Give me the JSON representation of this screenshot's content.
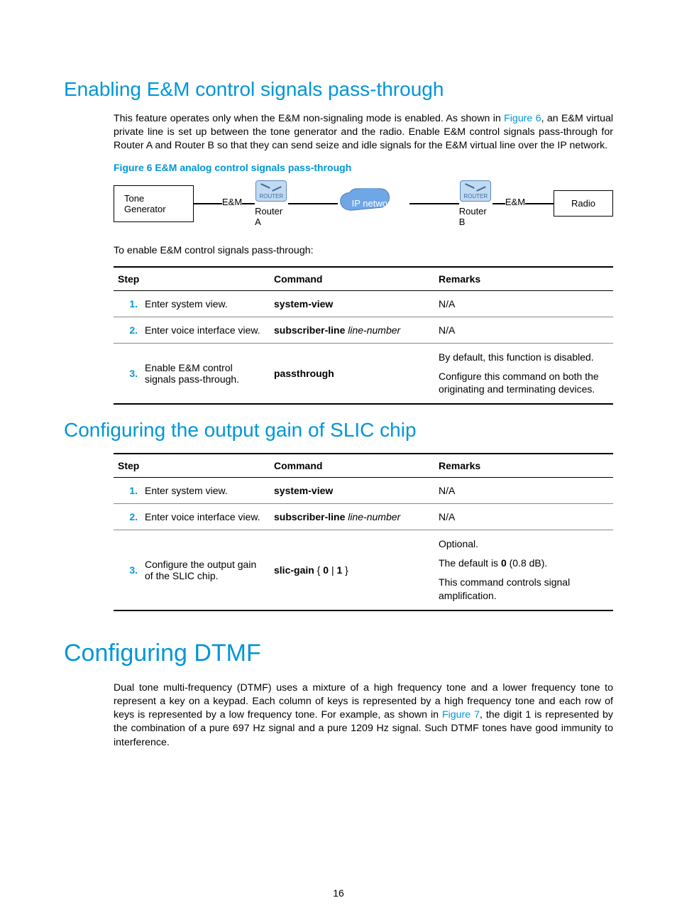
{
  "pageNumber": "16",
  "sections": {
    "s1": {
      "heading": "Enabling E&M control signals pass-through",
      "para_pre": "This feature operates only when the E&M non-signaling mode is enabled. As shown in ",
      "para_link": "Figure 6",
      "para_post": ", an E&M virtual private line is set up between the tone generator and the radio. Enable E&M control signals pass-through for Router A and Router B so that they can send seize and idle signals for the E&M virtual line over the IP network.",
      "fig_caption": "Figure 6 E&M analog control signals pass-through",
      "fig": {
        "toneGen": "Tone Generator",
        "em": "E&M",
        "routerA": "Router A",
        "ipnet": "IP network",
        "routerB": "Router B",
        "radio": "Radio",
        "routerWord": "ROUTER"
      },
      "lead": "To enable E&M control signals pass-through:",
      "table": {
        "h1": "Step",
        "h2": "Command",
        "h3": "Remarks",
        "r1": {
          "n": "1.",
          "step": "Enter system view.",
          "cmd_b": "system-view",
          "rem": "N/A"
        },
        "r2": {
          "n": "2.",
          "step": "Enter voice interface view.",
          "cmd_b": "subscriber-line",
          "cmd_i": " line-number",
          "rem": "N/A"
        },
        "r3": {
          "n": "3.",
          "step": "Enable E&M control signals pass-through.",
          "cmd_b": "passthrough",
          "rem1": "By default, this function is disabled.",
          "rem2": "Configure this command on both the originating and terminating devices."
        }
      }
    },
    "s2": {
      "heading": "Configuring the output gain of SLIC chip",
      "table": {
        "h1": "Step",
        "h2": "Command",
        "h3": "Remarks",
        "r1": {
          "n": "1.",
          "step": "Enter system view.",
          "cmd_b": "system-view",
          "rem": "N/A"
        },
        "r2": {
          "n": "2.",
          "step": "Enter voice interface view.",
          "cmd_b": "subscriber-line",
          "cmd_i": " line-number",
          "rem": "N/A"
        },
        "r3": {
          "n": "3.",
          "step": "Configure the output gain of the SLIC chip.",
          "cmd_b1": "slic-gain",
          "cmd_txt1": " { ",
          "cmd_b2": "0",
          "cmd_txt2": " | ",
          "cmd_b3": "1",
          "cmd_txt3": " }",
          "rem1": "Optional.",
          "rem2a": "The default is ",
          "rem2b": "0",
          "rem2c": " (0.8 dB).",
          "rem3": "This command controls signal amplification."
        }
      }
    },
    "s3": {
      "heading": "Configuring DTMF",
      "para_pre": "Dual tone multi-frequency (DTMF) uses a mixture of a high frequency tone and a lower frequency tone to represent a key on a keypad. Each column of keys is represented by a high frequency tone and each row of keys is represented by a low frequency tone. For example, as shown in ",
      "para_link": "Figure 7",
      "para_post": ", the digit 1 is represented by the combination of a pure 697 Hz signal and a pure 1209 Hz signal. Such DTMF tones have good immunity to interference."
    }
  }
}
